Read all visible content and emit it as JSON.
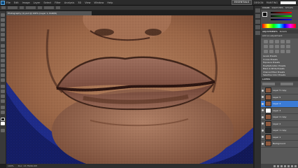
{
  "menubar": {
    "items": [
      "File",
      "Edit",
      "Image",
      "Layer",
      "Select",
      "Filter",
      "Analysis",
      "3D",
      "View",
      "Window",
      "Help"
    ],
    "essentials": "ESSENTIALS",
    "design": "DESIGN",
    "painting": "PAINTING"
  },
  "document": {
    "tab_title": "Photography (1).psd @ 100% (Layer 1, RGB/8)"
  },
  "status": {
    "zoom": "100%",
    "doc_size": "Doc: 13.7M/40.0M"
  },
  "panels": {
    "color_tabs": [
      "COLOR",
      "SWATCHES",
      "STYLES"
    ],
    "adjustments_tabs": [
      "ADJUSTMENTS",
      "MASKS"
    ],
    "adjustments_header": "Add an adjustment",
    "presets": [
      "Levels Presets",
      "Curves Presets",
      "Exposure Presets",
      "Hue/Saturation Presets",
      "Black & White Presets",
      "Channel Mixer Presets",
      "Selective Color Presets"
    ],
    "layers_tabs": [
      "LAYERS",
      "CHANNELS",
      "PATHS"
    ],
    "layers": [
      {
        "name": "Layer 5 copy",
        "thumb": "skin",
        "active": false
      },
      {
        "name": "Layer 5",
        "thumb": "skin",
        "active": false
      },
      {
        "name": "Layer 4",
        "thumb": "skin",
        "active": true
      },
      {
        "name": "Layer 3",
        "thumb": "mask",
        "active": false
      },
      {
        "name": "Layer 2 copy",
        "thumb": "skin",
        "active": false
      },
      {
        "name": "Layer 2",
        "thumb": "skin",
        "active": false
      },
      {
        "name": "Layer 1 copy",
        "thumb": "dark",
        "active": false
      },
      {
        "name": "Layer 1",
        "thumb": "skin",
        "active": false
      },
      {
        "name": "Background",
        "thumb": "skin",
        "active": false
      }
    ]
  }
}
